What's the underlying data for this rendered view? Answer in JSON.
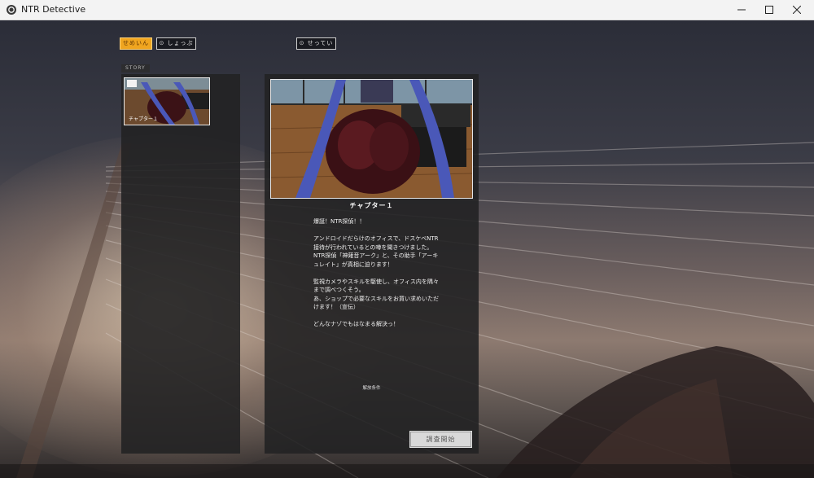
{
  "window": {
    "title": "NTR Detective"
  },
  "tabs": [
    {
      "label": "せめいん",
      "active": true
    },
    {
      "label": "⊙ しょっぷ",
      "active": false
    },
    {
      "label": "⊙ せってい",
      "active": false
    }
  ],
  "story": {
    "section_label": "STORY",
    "chapters": [
      {
        "label": "チャプター１"
      }
    ]
  },
  "detail": {
    "title": "チャプター１",
    "description": "爆誕！NTR探偵！！\n\nアンドロイドだらけのオフィスで、ドスケベNTR接待が行われているとの噂を聞きつけました。\nNTR探偵「神薙音アーク」と、その助手「アーキュレイト」が真相に迫ります！\n\n監視カメラやスキルを駆使し、オフィス内を隅々まで調べつくそう。\nあ、ショップで必要なスキルをお買い求めいただけます！（宣伝）\n\nどんなナゾでもはなまる解決っ！",
    "unlock_condition": "解放条件",
    "start_button": "調査開始"
  },
  "colors": {
    "accent": "#f0a51f",
    "panel": "#222224"
  }
}
